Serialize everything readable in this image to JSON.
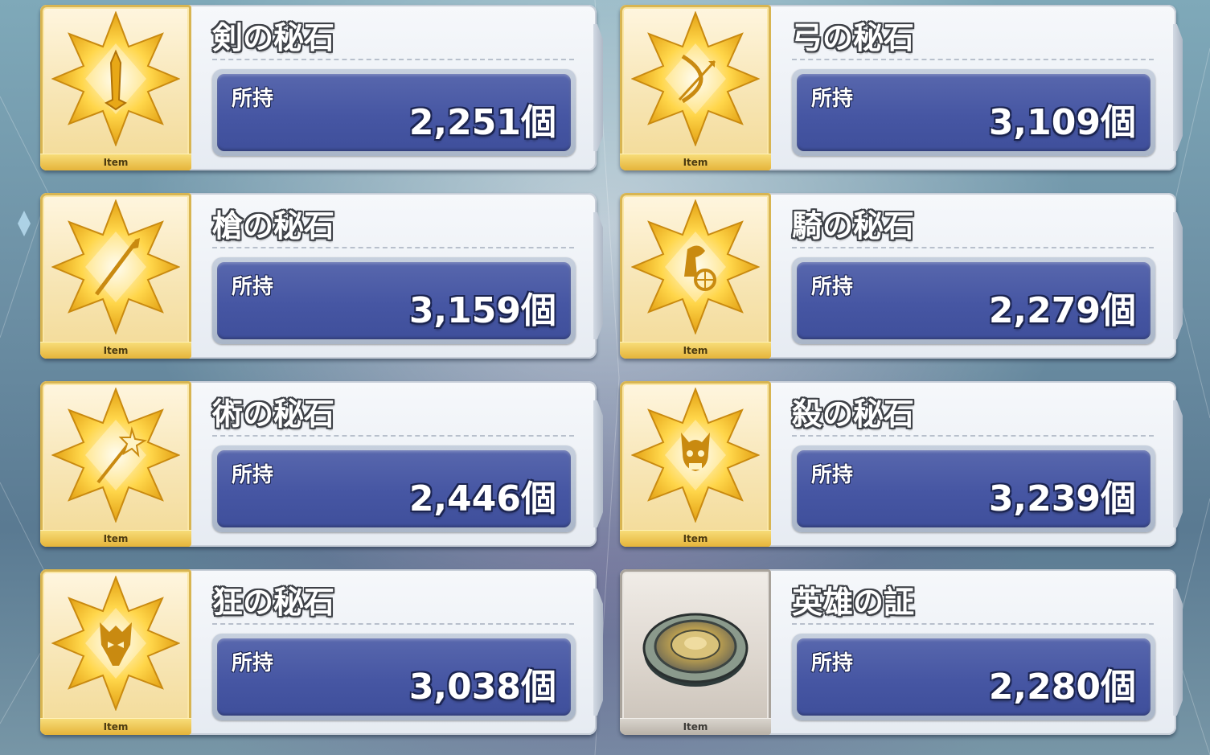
{
  "owned_label": "所持",
  "item_tag": "Item",
  "items": [
    {
      "name": "剣の秘石",
      "count": "2,251個",
      "icon": "saber-gem-icon"
    },
    {
      "name": "弓の秘石",
      "count": "3,109個",
      "icon": "archer-gem-icon"
    },
    {
      "name": "槍の秘石",
      "count": "3,159個",
      "icon": "lancer-gem-icon"
    },
    {
      "name": "騎の秘石",
      "count": "2,279個",
      "icon": "rider-gem-icon"
    },
    {
      "name": "術の秘石",
      "count": "2,446個",
      "icon": "caster-gem-icon"
    },
    {
      "name": "殺の秘石",
      "count": "3,239個",
      "icon": "assassin-gem-icon"
    },
    {
      "name": "狂の秘石",
      "count": "3,038個",
      "icon": "berserker-gem-icon"
    },
    {
      "name": "英雄の証",
      "count": "2,280個",
      "icon": "hero-proof-medal-icon"
    }
  ],
  "colors": {
    "panel_blue": "#4656a3",
    "gold_frame": "#d8b552",
    "silver_frame": "#a9a39b"
  }
}
